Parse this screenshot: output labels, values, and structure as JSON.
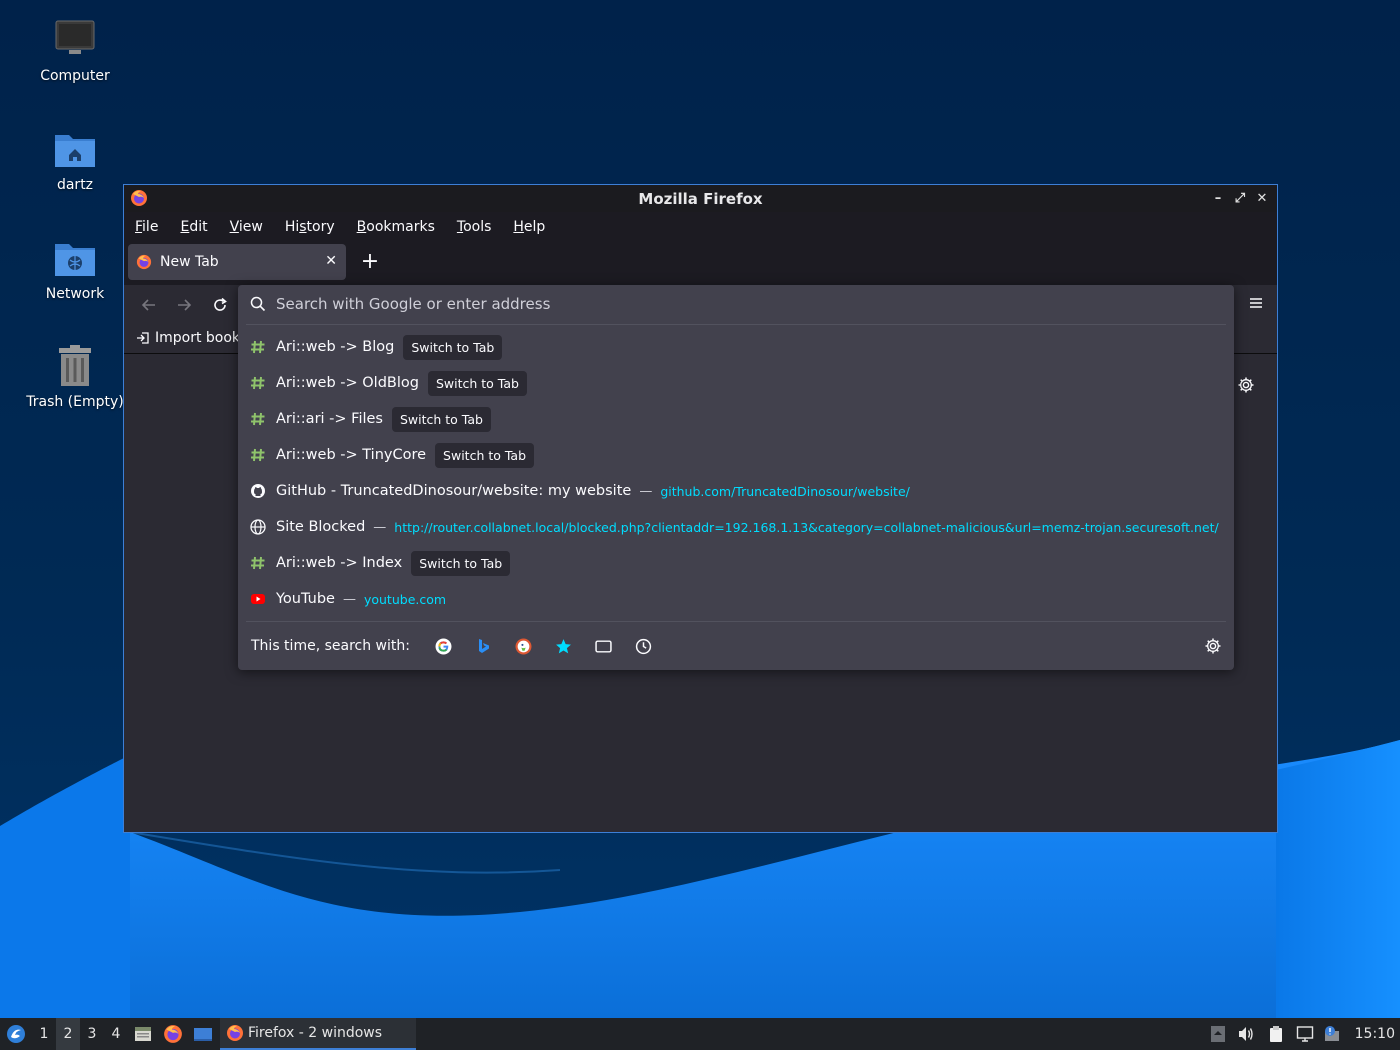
{
  "desktop": {
    "icons": [
      {
        "label": "Computer"
      },
      {
        "label": "dartz"
      },
      {
        "label": "Network"
      },
      {
        "label": "Trash (Empty)"
      }
    ]
  },
  "window": {
    "title": "Mozilla Firefox",
    "controls": {
      "minimize": "–",
      "maximize": "⤢",
      "close": "✕"
    }
  },
  "menubar": {
    "items": [
      {
        "accel": "F",
        "rest": "ile"
      },
      {
        "accel": "E",
        "rest": "dit"
      },
      {
        "accel": "V",
        "rest": "iew"
      },
      {
        "pre": "Hi",
        "accel": "s",
        "rest": "tory"
      },
      {
        "accel": "B",
        "rest": "ookmarks"
      },
      {
        "accel": "T",
        "rest": "ools"
      },
      {
        "accel": "H",
        "rest": "elp"
      }
    ]
  },
  "tabs": {
    "active_title": "New Tab",
    "close_glyph": "✕",
    "new_tab_glyph": "+"
  },
  "bookmarks_bar": {
    "import_label": "Import book"
  },
  "urlbar": {
    "placeholder": "Search with Google or enter address",
    "value": "",
    "results": [
      {
        "icon": "hashtag-icon",
        "title": "Ari::web -> Blog",
        "badge": "Switch to Tab"
      },
      {
        "icon": "hashtag-icon",
        "title": "Ari::web -> OldBlog",
        "badge": "Switch to Tab"
      },
      {
        "icon": "hashtag-icon",
        "title": "Ari::ari -> Files",
        "badge": "Switch to Tab"
      },
      {
        "icon": "hashtag-icon",
        "title": "Ari::web -> TinyCore",
        "badge": "Switch to Tab"
      },
      {
        "icon": "github-icon",
        "title": "GitHub - TruncatedDinosour/website: my website",
        "dash": "—",
        "url": "github.com/TruncatedDinosour/website/"
      },
      {
        "icon": "globe-icon",
        "title": "Site Blocked",
        "dash": "—",
        "url": "http://router.collabnet.local/blocked.php?clientaddr=192.168.1.13&category=collabnet-malicious&url=memz-trojan.securesoft.net/"
      },
      {
        "icon": "hashtag-icon",
        "title": "Ari::web -> Index",
        "badge": "Switch to Tab"
      },
      {
        "icon": "youtube-icon",
        "title": "YouTube",
        "dash": "—",
        "url": "youtube.com"
      }
    ],
    "one_off": {
      "label": "This time, search with:",
      "engines": [
        "google-icon",
        "bing-icon",
        "duckduckgo-icon",
        "bookmarks-star-icon",
        "tabs-icon",
        "history-icon"
      ]
    }
  },
  "taskbar": {
    "workspaces": [
      "1",
      "2",
      "3",
      "4"
    ],
    "active_workspace": "2",
    "task_label": "Firefox - 2 windows",
    "clock": "15:10"
  },
  "colors": {
    "accent": "#3d7fd6",
    "url_link": "#00ddff",
    "panel": "#42414d",
    "toolbar": "#2b2a33"
  }
}
